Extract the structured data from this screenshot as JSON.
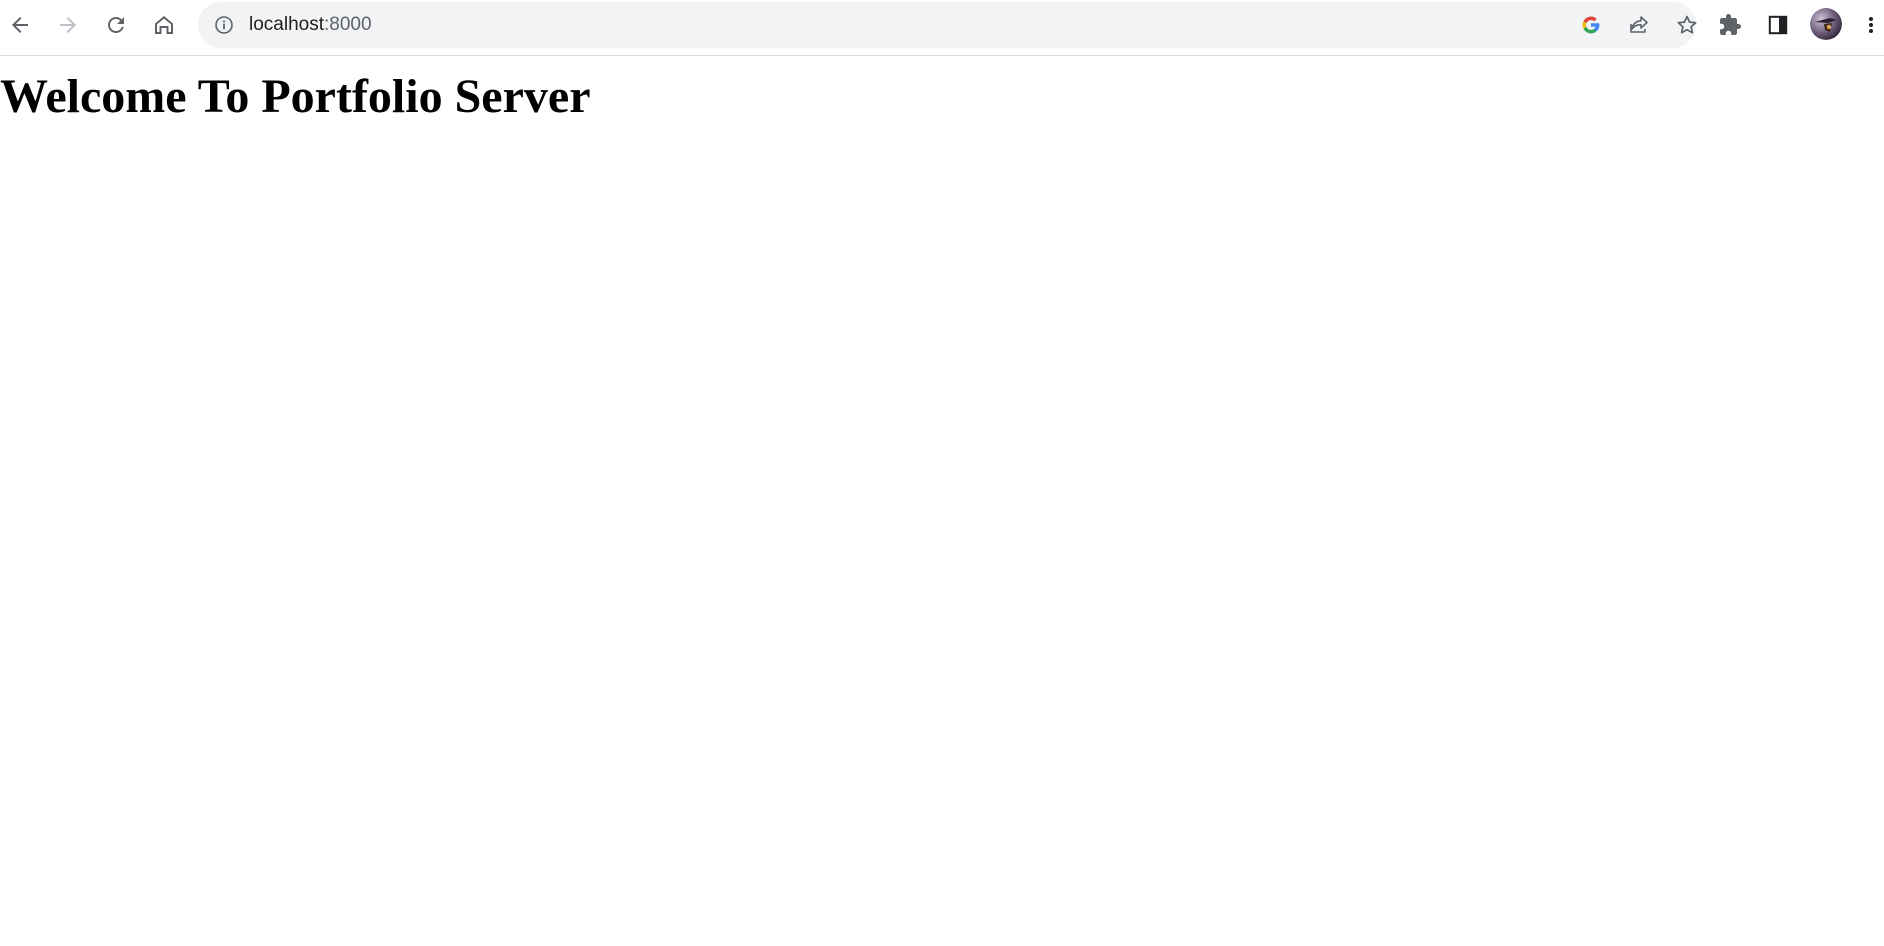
{
  "browser": {
    "url_host": "localhost",
    "url_port": ":8000",
    "icons": {
      "back": "arrow-left-icon",
      "forward": "arrow-right-icon",
      "reload": "reload-icon",
      "home": "home-icon",
      "site_info": "info-icon",
      "google_lens": "google-icon",
      "share": "share-icon",
      "bookmark": "star-icon",
      "extensions": "puzzle-icon",
      "side_panel": "side-panel-icon",
      "profile": "avatar",
      "menu": "kebab-menu-icon"
    },
    "colors": {
      "omnibox_bg": "#f1f3f4",
      "icon": "#5f6368",
      "icon_disabled": "#bdc1c6"
    }
  },
  "page": {
    "heading": "Welcome To Portfolio Server"
  }
}
